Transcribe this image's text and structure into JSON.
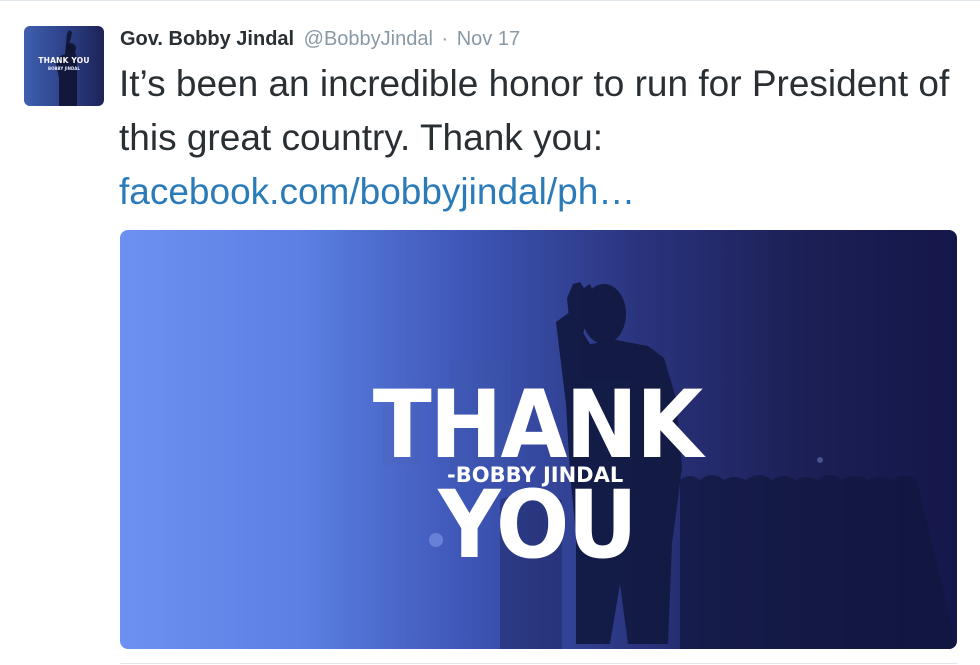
{
  "tweet": {
    "author_name": "Gov. Bobby Jindal",
    "handle": "@BobbyJindal",
    "separator": "·",
    "date": "Nov 17",
    "text": "It’s been an incredible honor to run for President of this great country. Thank you:",
    "link_text": "facebook.com/bobbyjindal/ph…",
    "link_color": "#2b7bb9"
  },
  "avatar": {
    "title": "THANK YOU",
    "subtitle": "BOBBY JINDAL"
  },
  "media": {
    "headline": "THANK YOU",
    "signature": "-BOBBY JINDAL",
    "gradient_colors": [
      "#6c91f2",
      "#3d55b5",
      "#1c1f55"
    ]
  }
}
